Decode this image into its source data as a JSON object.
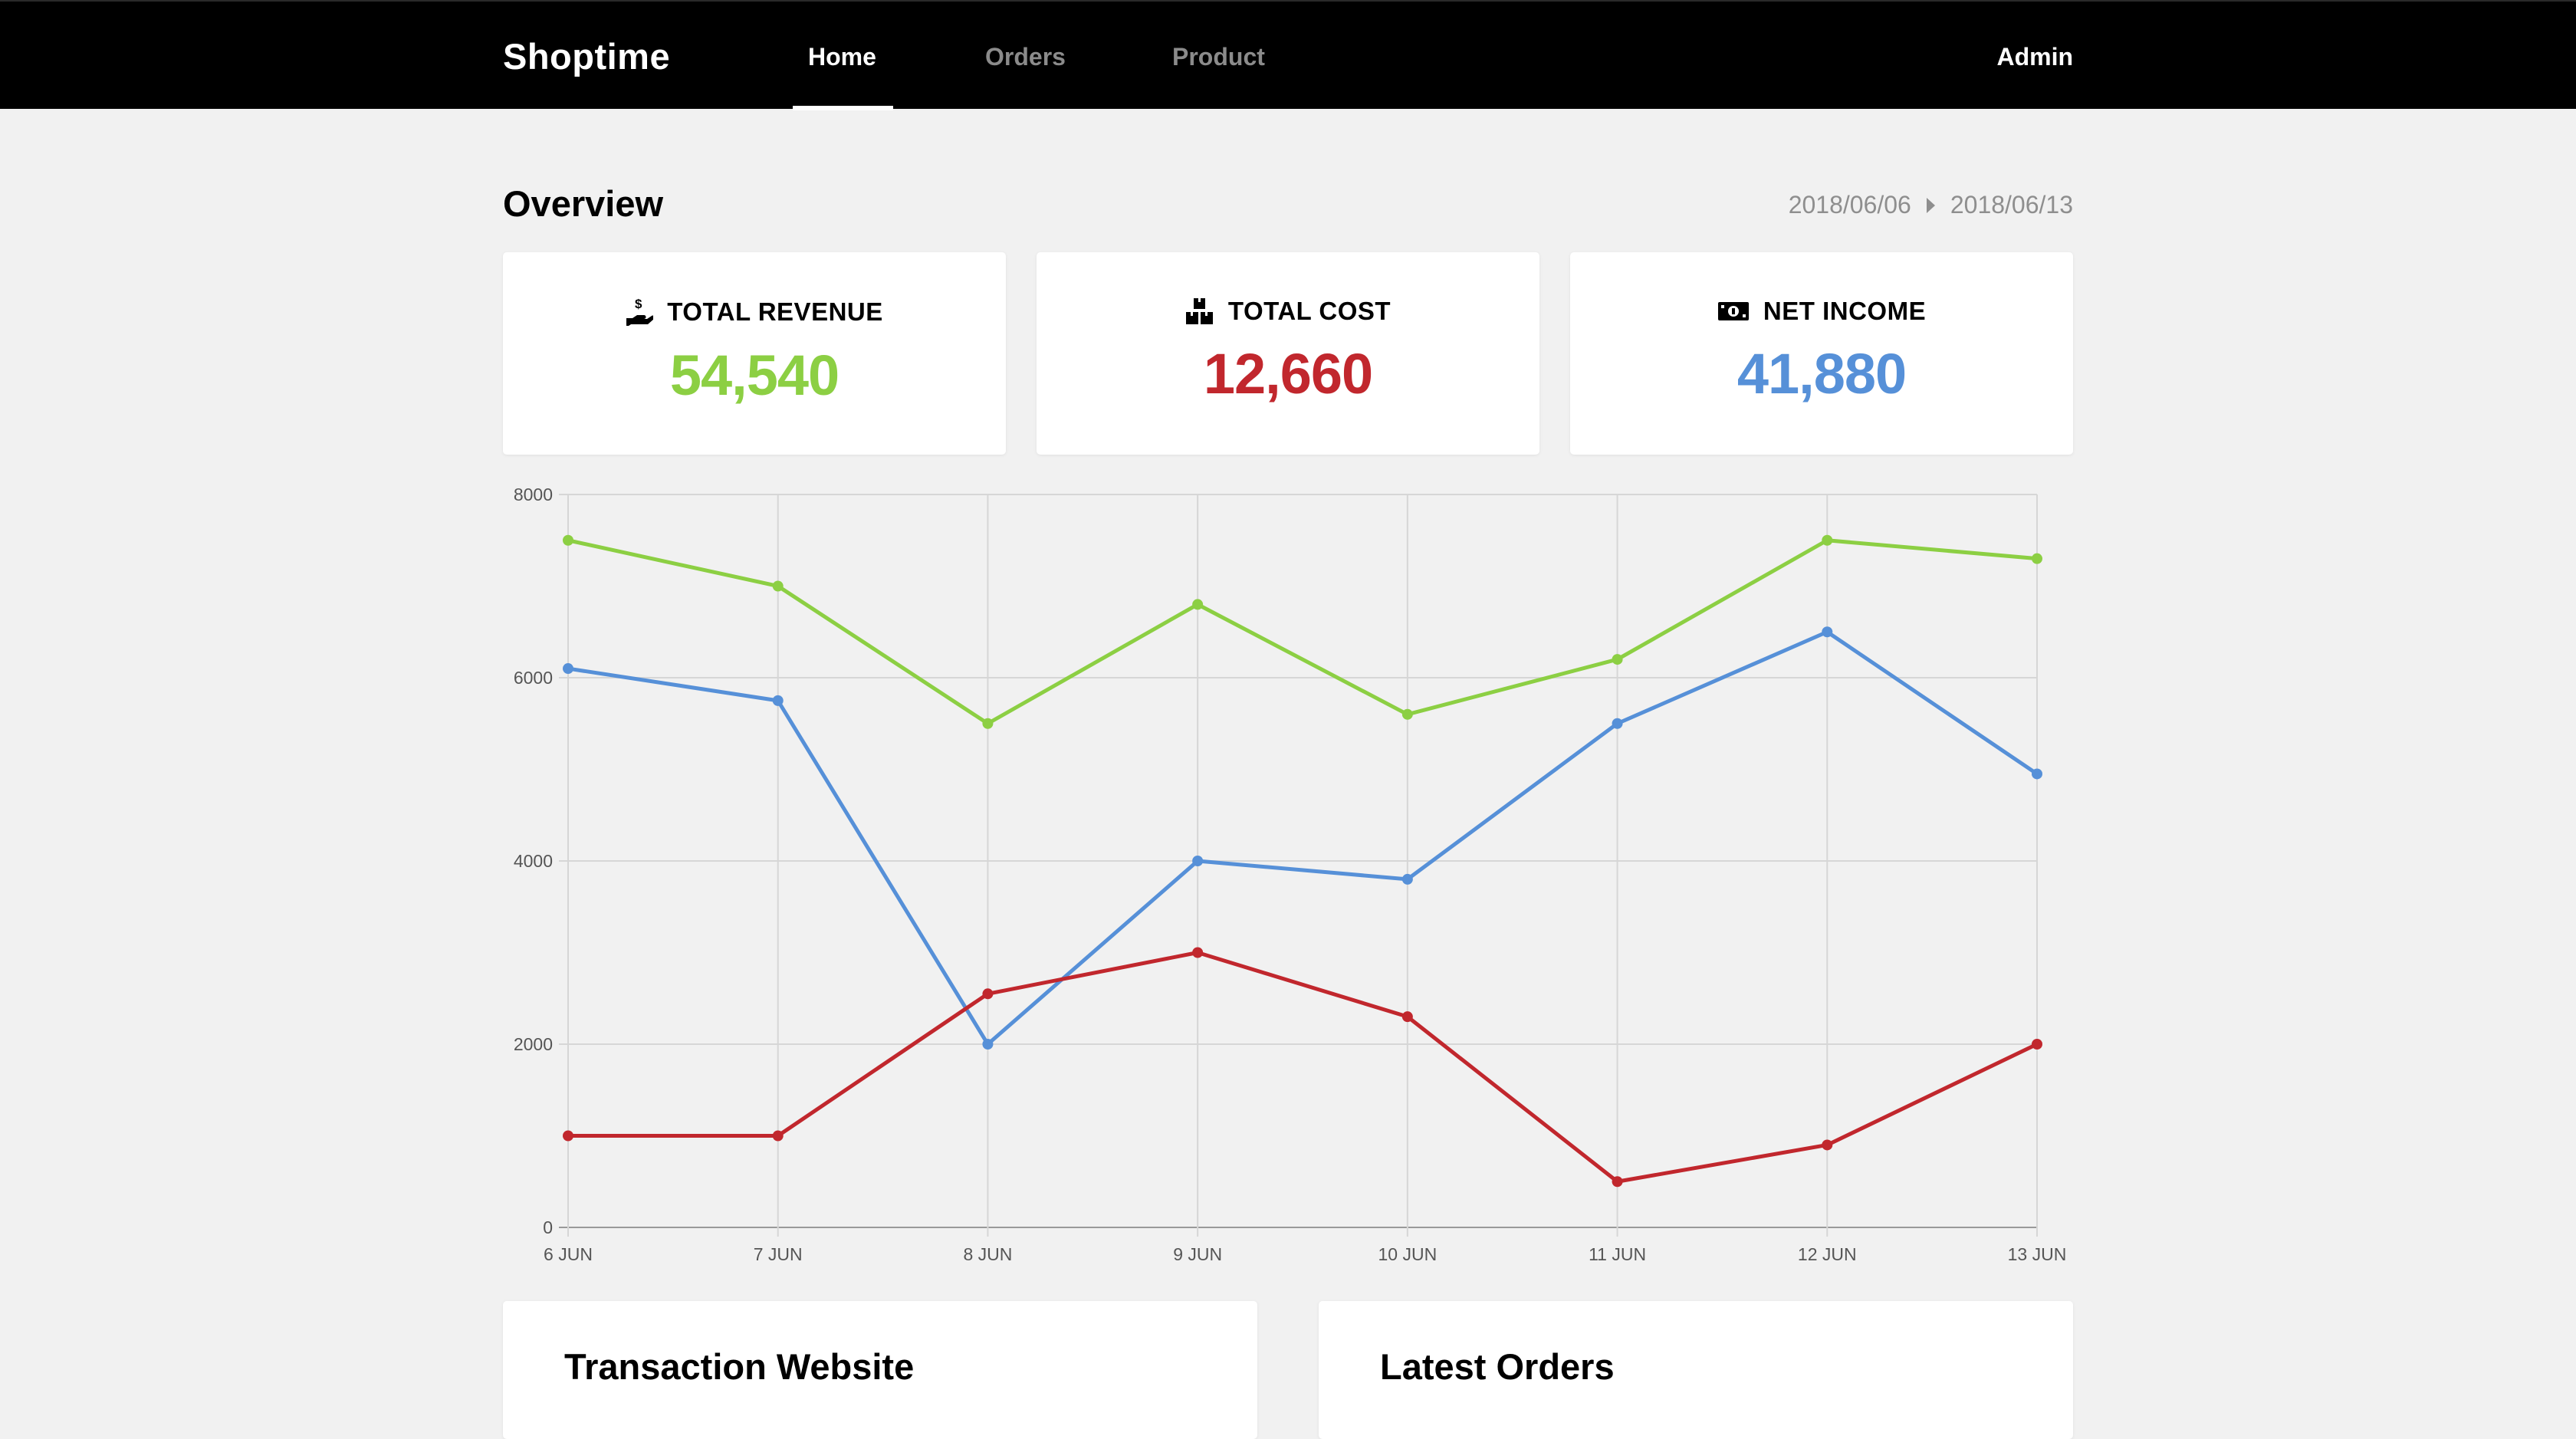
{
  "nav": {
    "brand": "Shoptime",
    "tabs": [
      {
        "label": "Home",
        "active": true
      },
      {
        "label": "Orders",
        "active": false
      },
      {
        "label": "Product",
        "active": false
      }
    ],
    "user": "Admin"
  },
  "overview": {
    "title": "Overview",
    "date_from": "2018/06/06",
    "date_to": "2018/06/13"
  },
  "cards": [
    {
      "label": "TOTAL REVENUE",
      "value": "54,540",
      "color": "#8ccf43",
      "icon": "hand-dollar-icon"
    },
    {
      "label": "TOTAL COST",
      "value": "12,660",
      "color": "#c1272d",
      "icon": "boxes-icon"
    },
    {
      "label": "NET INCOME",
      "value": "41,880",
      "color": "#5690d8",
      "icon": "cash-icon"
    }
  ],
  "chart_data": {
    "type": "line",
    "categories": [
      "6 JUN",
      "7 JUN",
      "8 JUN",
      "9 JUN",
      "10 JUN",
      "11 JUN",
      "12 JUN",
      "13 JUN"
    ],
    "ylim": [
      0,
      8000
    ],
    "yticks": [
      "0",
      "2000",
      "4000",
      "6000",
      "8000"
    ],
    "grid": true,
    "series": [
      {
        "color": "#8ccf43",
        "values": [
          7500,
          7000,
          5500,
          6800,
          5600,
          6200,
          7500,
          7300
        ]
      },
      {
        "color": "#5690d8",
        "values": [
          6100,
          5750,
          2000,
          4000,
          3800,
          5500,
          6500,
          4950
        ]
      },
      {
        "color": "#c1272d",
        "values": [
          1000,
          1000,
          2550,
          3000,
          2300,
          500,
          900,
          2000
        ]
      }
    ]
  },
  "panels": {
    "transaction_title": "Transaction Website",
    "orders_title": "Latest Orders"
  }
}
